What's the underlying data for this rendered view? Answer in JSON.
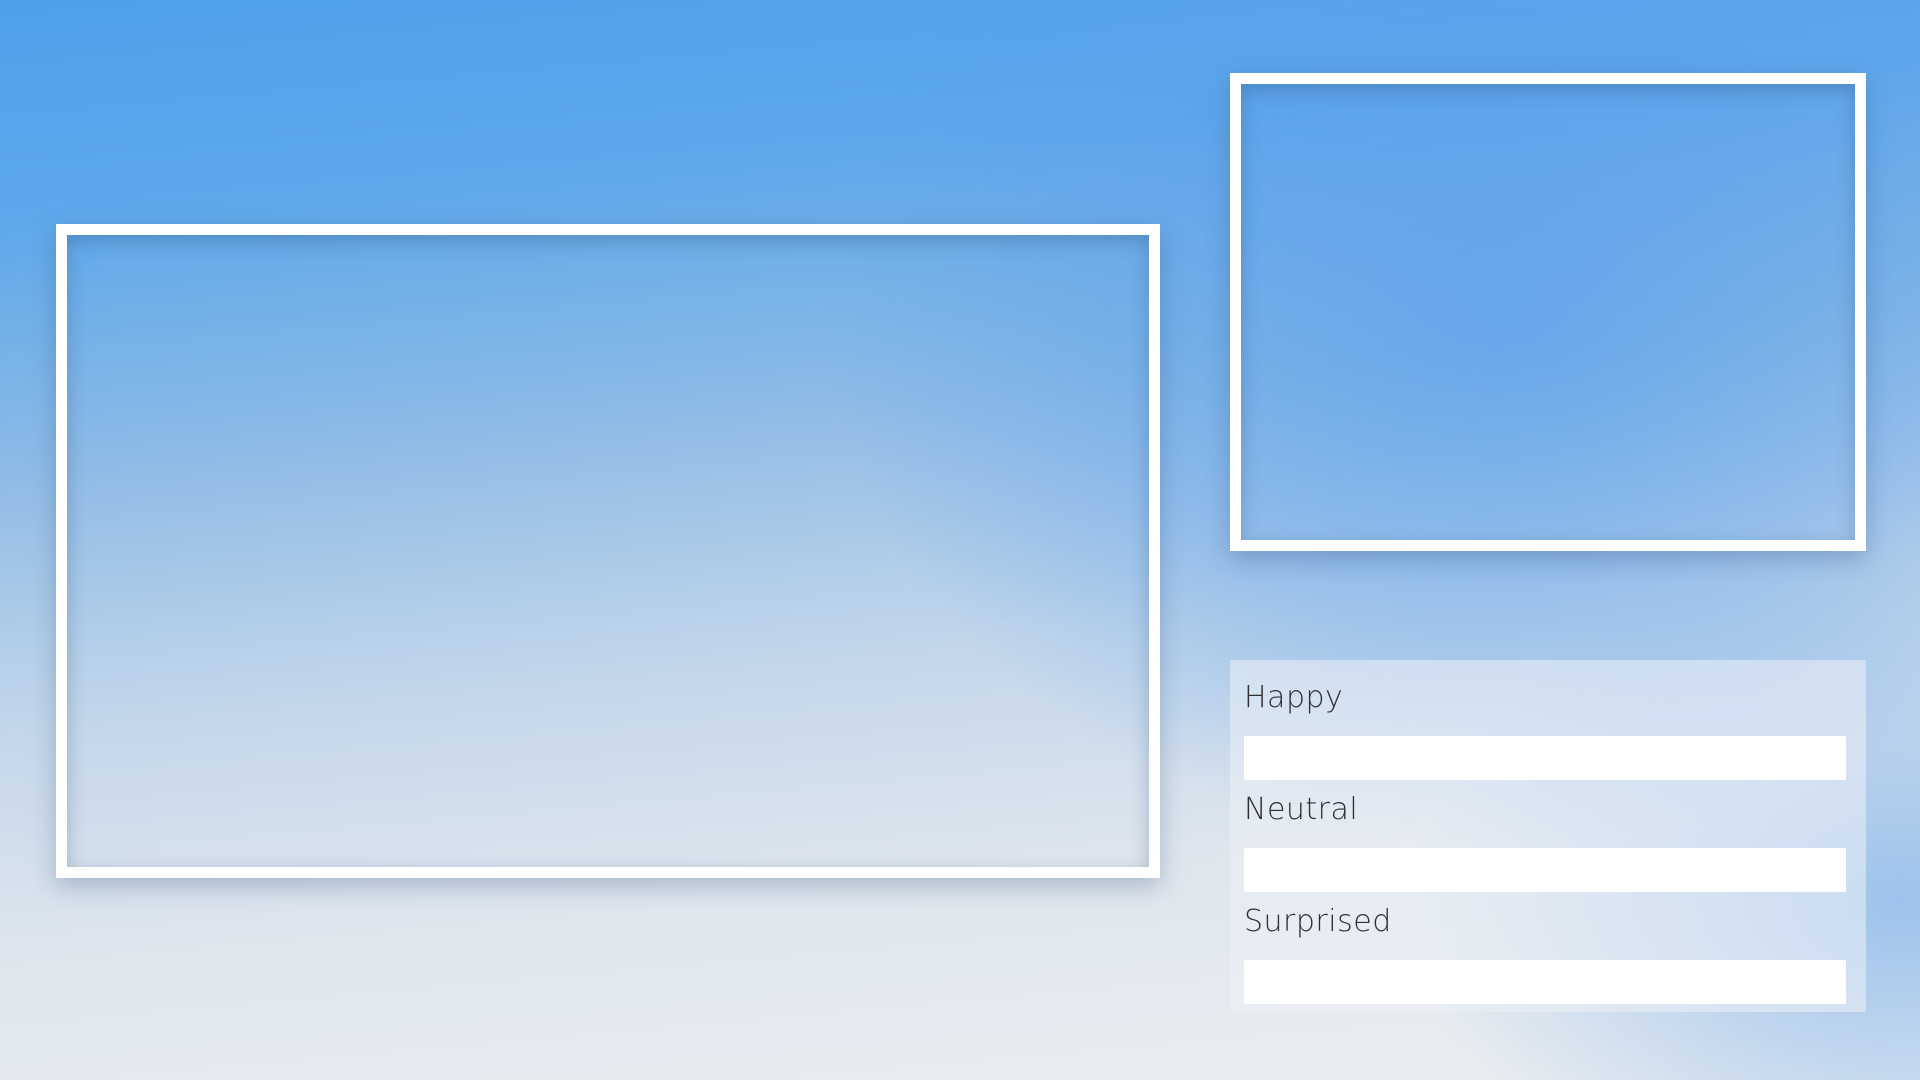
{
  "emotions": [
    {
      "label": "Happy"
    },
    {
      "label": "Neutral"
    },
    {
      "label": "Surprised"
    }
  ],
  "colors": {
    "frame_border": "#ffffff",
    "bar_track": "#ffffff",
    "label_text": "#2d2f33"
  }
}
